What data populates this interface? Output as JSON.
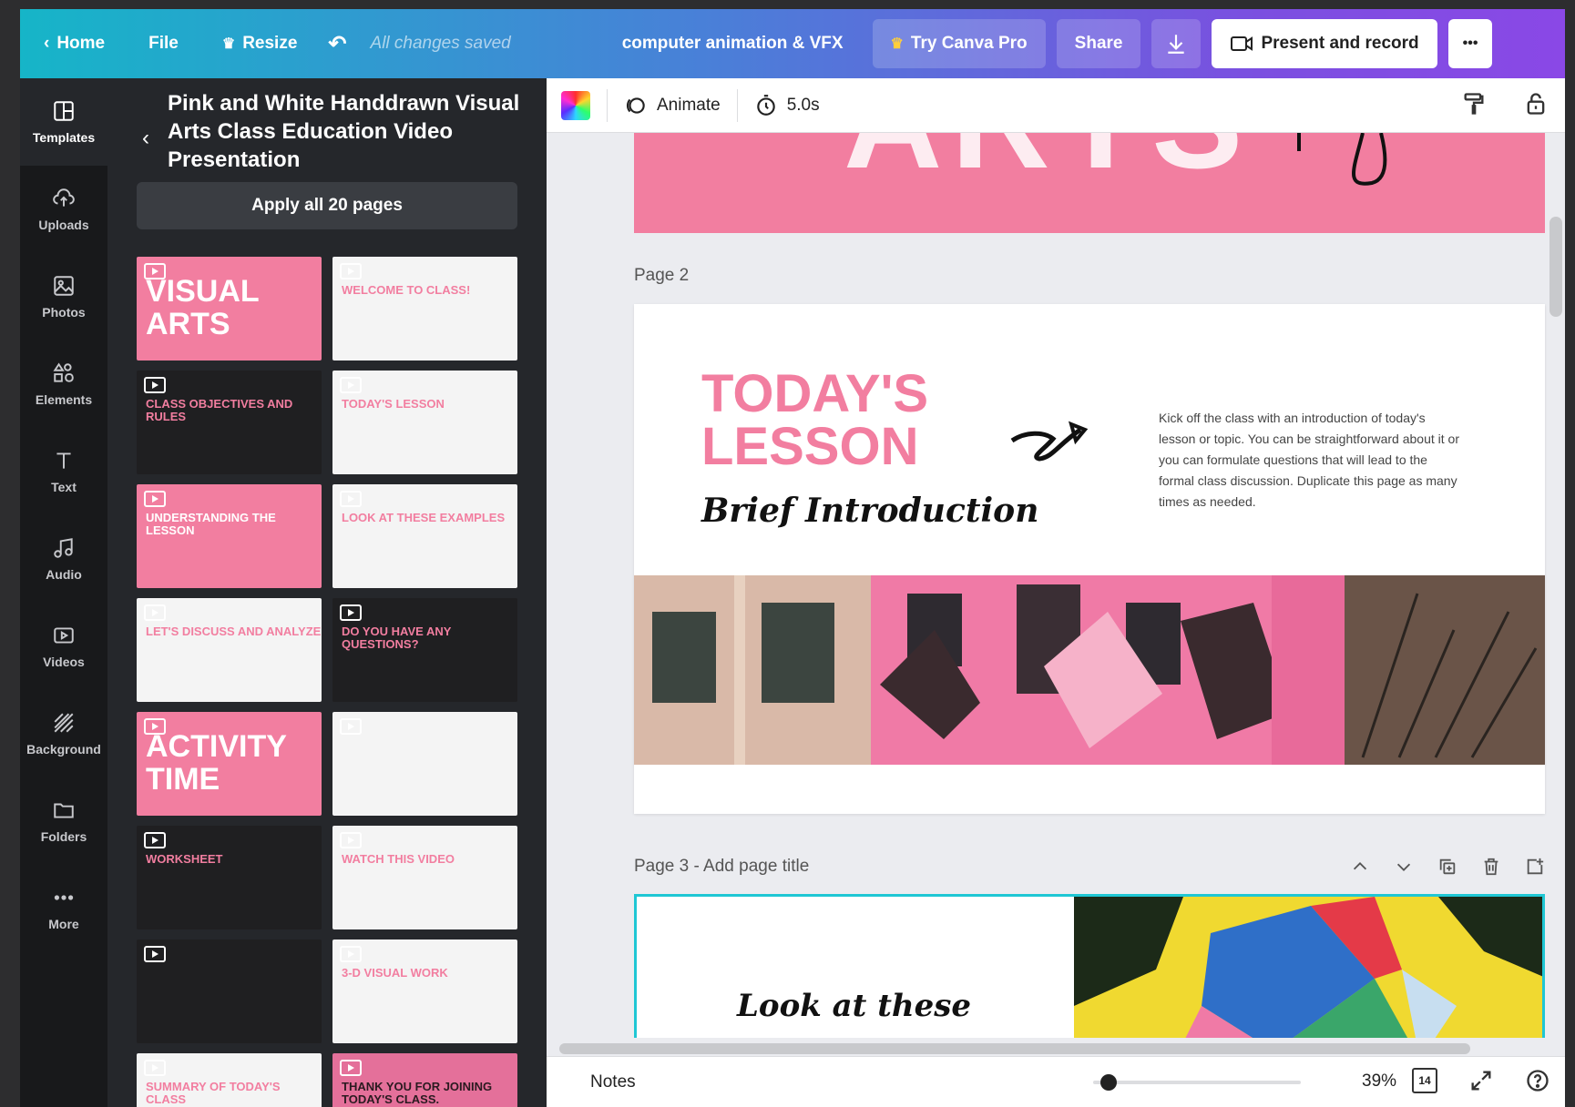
{
  "topbar": {
    "home": "Home",
    "file": "File",
    "resize": "Resize",
    "saved_status": "All changes saved",
    "project_title": "computer animation & VFX",
    "try_pro": "Try Canva Pro",
    "share": "Share",
    "present_record": "Present and record",
    "more": "•••"
  },
  "rail": {
    "items": [
      {
        "label": "Templates",
        "icon": "templates-icon"
      },
      {
        "label": "Uploads",
        "icon": "upload-icon"
      },
      {
        "label": "Photos",
        "icon": "photos-icon"
      },
      {
        "label": "Elements",
        "icon": "elements-icon"
      },
      {
        "label": "Text",
        "icon": "text-icon"
      },
      {
        "label": "Audio",
        "icon": "audio-icon"
      },
      {
        "label": "Videos",
        "icon": "videos-icon"
      },
      {
        "label": "Background",
        "icon": "background-icon"
      },
      {
        "label": "Folders",
        "icon": "folders-icon"
      },
      {
        "label": "More",
        "icon": "more-icon"
      }
    ]
  },
  "panel": {
    "title": "Pink and White Handdrawn Visual Arts Class Education Video Presentation",
    "apply_label": "Apply all 20 pages",
    "thumbnails": [
      {
        "text": "VISUAL ARTS",
        "style": "pink"
      },
      {
        "text": "WELCOME TO CLASS!",
        "style": "white"
      },
      {
        "text": "CLASS OBJECTIVES AND RULES",
        "style": "dark"
      },
      {
        "text": "TODAY'S LESSON",
        "style": "white"
      },
      {
        "text": "UNDERSTANDING THE LESSON",
        "style": "pink"
      },
      {
        "text": "LOOK AT THESE EXAMPLES",
        "style": "white"
      },
      {
        "text": "LET'S DISCUSS AND ANALYZE",
        "style": "white"
      },
      {
        "text": "DO YOU HAVE ANY QUESTIONS?",
        "style": "dark"
      },
      {
        "text": "ACTIVITY TIME",
        "style": "pink"
      },
      {
        "text": "",
        "style": "white"
      },
      {
        "text": "WORKSHEET",
        "style": "dark"
      },
      {
        "text": "WATCH THIS VIDEO",
        "style": "white"
      },
      {
        "text": "",
        "style": "dark"
      },
      {
        "text": "3-D VISUAL WORK",
        "style": "white"
      },
      {
        "text": "SUMMARY OF TODAY'S CLASS",
        "style": "white"
      },
      {
        "text": "THANK YOU FOR JOINING TODAY'S CLASS.",
        "style": "pinkdark"
      }
    ]
  },
  "editor_toolbar": {
    "animate": "Animate",
    "duration": "5.0s"
  },
  "canvas": {
    "page1_fragment": "ARTS",
    "page2_label": "Page 2",
    "page2": {
      "heading_line1": "TODAY'S",
      "heading_line2": "LESSON",
      "subheading": "Brief Introduction",
      "description": "Kick off the class with an introduction of today's lesson or topic. You can be straightforward about it or you can formulate questions that will lead to the formal class discussion. Duplicate this page as many times as needed."
    },
    "page3_label": "Page 3 - Add page title",
    "page3": {
      "heading": "Look at these"
    }
  },
  "bottombar": {
    "notes": "Notes",
    "zoom": "39%",
    "zoom_fraction": 0.39,
    "page_count": "14"
  },
  "colors": {
    "accent_pink": "#f27ea0",
    "selection_cyan": "#1fc7d4",
    "topbar_start": "#16b5c8",
    "topbar_end": "#8a48e6"
  }
}
